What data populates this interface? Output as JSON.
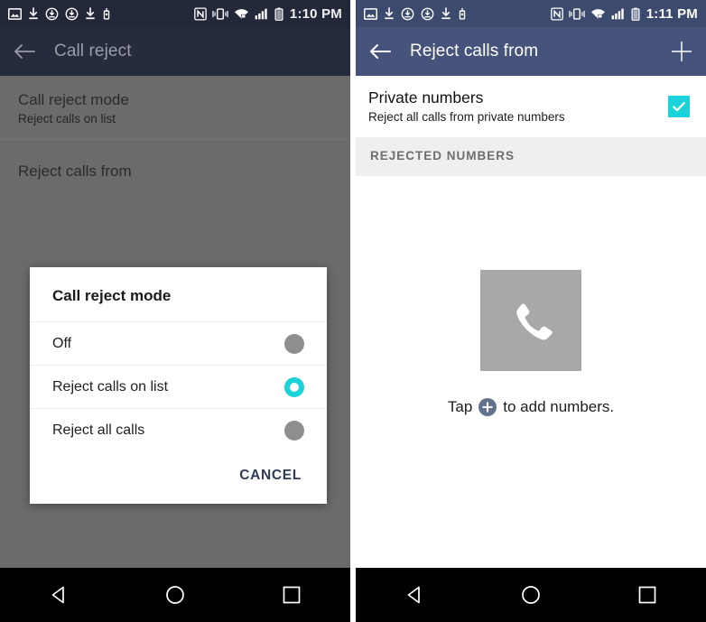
{
  "left": {
    "status_bar": {
      "icons": [
        "image-icon",
        "download-icon",
        "sync-icon",
        "sync-icon",
        "download-icon",
        "usb-icon"
      ],
      "right_icons": [
        "nfc-icon",
        "vibrate-icon",
        "wifi-secure-icon",
        "signal-icon",
        "battery-icon"
      ],
      "time": "1:10 PM",
      "background": "#232838"
    },
    "app_bar": {
      "back_label": "back-arrow",
      "title": "Call reject",
      "background": "#262c3e",
      "title_color": "#9a9da6"
    },
    "settings": [
      {
        "title": "Call reject mode",
        "subtitle": "Reject calls on list"
      },
      {
        "title": "Reject calls from",
        "subtitle": ""
      }
    ],
    "dialog": {
      "title": "Call reject mode",
      "options": [
        {
          "label": "Off",
          "selected": false
        },
        {
          "label": "Reject calls on list",
          "selected": true
        },
        {
          "label": "Reject all calls",
          "selected": false
        }
      ],
      "cancel_label": "CANCEL",
      "accent_color": "#19d3d8"
    }
  },
  "right": {
    "status_bar": {
      "icons": [
        "image-icon",
        "download-icon",
        "sync-icon",
        "sync-icon",
        "download-icon",
        "usb-icon"
      ],
      "right_icons": [
        "nfc-icon",
        "vibrate-icon",
        "wifi-secure-icon",
        "signal-icon",
        "battery-icon"
      ],
      "time": "1:11 PM",
      "background": "#3c4a6d"
    },
    "app_bar": {
      "title": "Reject calls from",
      "add_label": "add",
      "background": "#46537a"
    },
    "private_numbers": {
      "title": "Private numbers",
      "subtitle": "Reject all calls from private numbers",
      "checked": true,
      "accent_color": "#19d3d8"
    },
    "section_header": "REJECTED NUMBERS",
    "empty_state": {
      "icon": "phone-icon",
      "text_before": "Tap",
      "text_after": "to add numbers.",
      "badge_icon": "plus-icon"
    }
  },
  "nav_bar": {
    "back": "back-triangle",
    "home": "home-circle",
    "recents": "recents-square"
  }
}
